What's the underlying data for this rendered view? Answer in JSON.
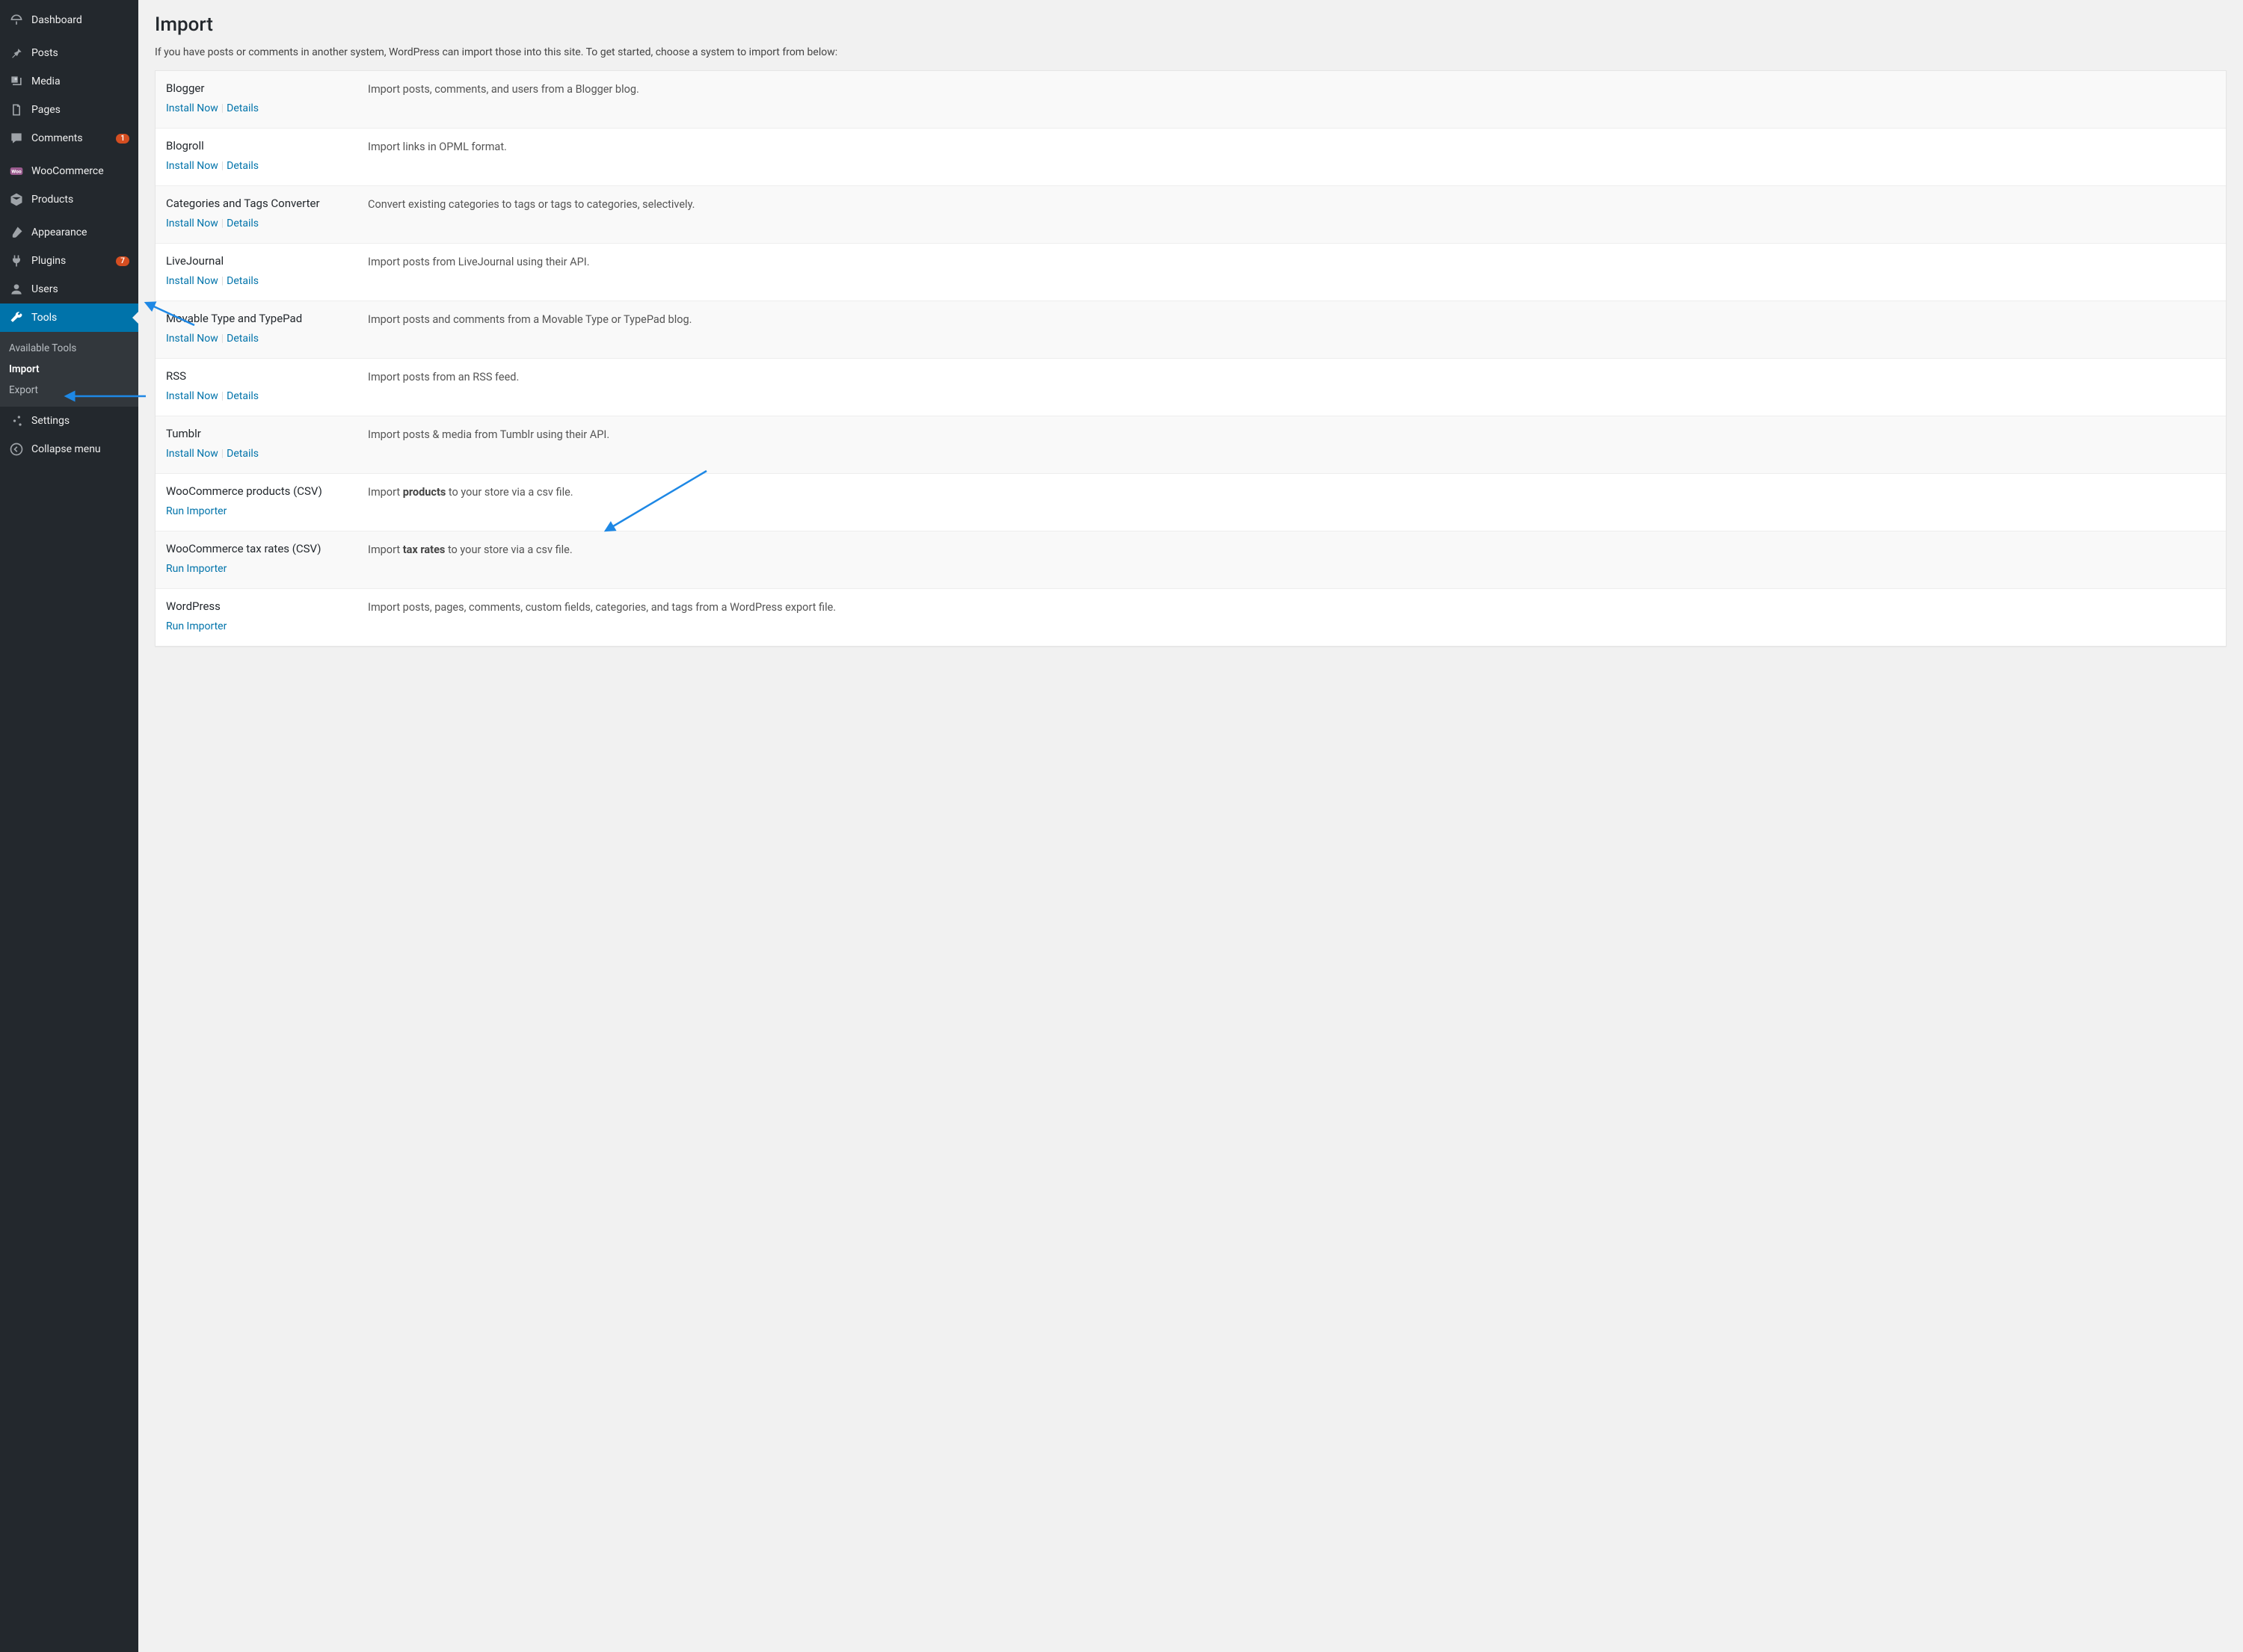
{
  "sidebar": {
    "items": [
      {
        "id": "dashboard",
        "label": "Dashboard",
        "icon": "dashboard"
      },
      {
        "id": "posts",
        "label": "Posts",
        "icon": "pin"
      },
      {
        "id": "media",
        "label": "Media",
        "icon": "media"
      },
      {
        "id": "pages",
        "label": "Pages",
        "icon": "page"
      },
      {
        "id": "comments",
        "label": "Comments",
        "icon": "comment",
        "badge": "1"
      },
      {
        "id": "woocommerce",
        "label": "WooCommerce",
        "icon": "woo"
      },
      {
        "id": "products",
        "label": "Products",
        "icon": "box"
      },
      {
        "id": "appearance",
        "label": "Appearance",
        "icon": "brush"
      },
      {
        "id": "plugins",
        "label": "Plugins",
        "icon": "plug",
        "badge": "7"
      },
      {
        "id": "users",
        "label": "Users",
        "icon": "user"
      },
      {
        "id": "tools",
        "label": "Tools",
        "icon": "wrench",
        "active": true,
        "submenu": [
          {
            "id": "available",
            "label": "Available Tools"
          },
          {
            "id": "import",
            "label": "Import",
            "current": true
          },
          {
            "id": "export",
            "label": "Export"
          }
        ]
      },
      {
        "id": "settings",
        "label": "Settings",
        "icon": "sliders"
      },
      {
        "id": "collapse",
        "label": "Collapse menu",
        "icon": "collapse"
      }
    ]
  },
  "page": {
    "title": "Import",
    "intro": "If you have posts or comments in another system, WordPress can import those into this site. To get started, choose a system to import from below:"
  },
  "actions": {
    "install": "Install Now",
    "details": "Details",
    "run": "Run Importer"
  },
  "importers": [
    {
      "name": "Blogger",
      "desc": "Import posts, comments, and users from a Blogger blog.",
      "mode": "install"
    },
    {
      "name": "Blogroll",
      "desc": "Import links in OPML format.",
      "mode": "install"
    },
    {
      "name": "Categories and Tags Converter",
      "desc": "Convert existing categories to tags or tags to categories, selectively.",
      "mode": "install"
    },
    {
      "name": "LiveJournal",
      "desc": "Import posts from LiveJournal using their API.",
      "mode": "install"
    },
    {
      "name": "Movable Type and TypePad",
      "desc": "Import posts and comments from a Movable Type or TypePad blog.",
      "mode": "install"
    },
    {
      "name": "RSS",
      "desc": "Import posts from an RSS feed.",
      "mode": "install"
    },
    {
      "name": "Tumblr",
      "desc": "Import posts & media from Tumblr using their API.",
      "mode": "install"
    },
    {
      "name": "WooCommerce products (CSV)",
      "desc": "Import <strong>products</strong> to your store via a csv file.",
      "mode": "run",
      "html": true
    },
    {
      "name": "WooCommerce tax rates (CSV)",
      "desc": "Import <strong>tax rates</strong> to your store via a csv file.",
      "mode": "run",
      "html": true
    },
    {
      "name": "WordPress",
      "desc": "Import posts, pages, comments, custom fields, categories, and tags from a WordPress export file.",
      "mode": "run"
    }
  ]
}
